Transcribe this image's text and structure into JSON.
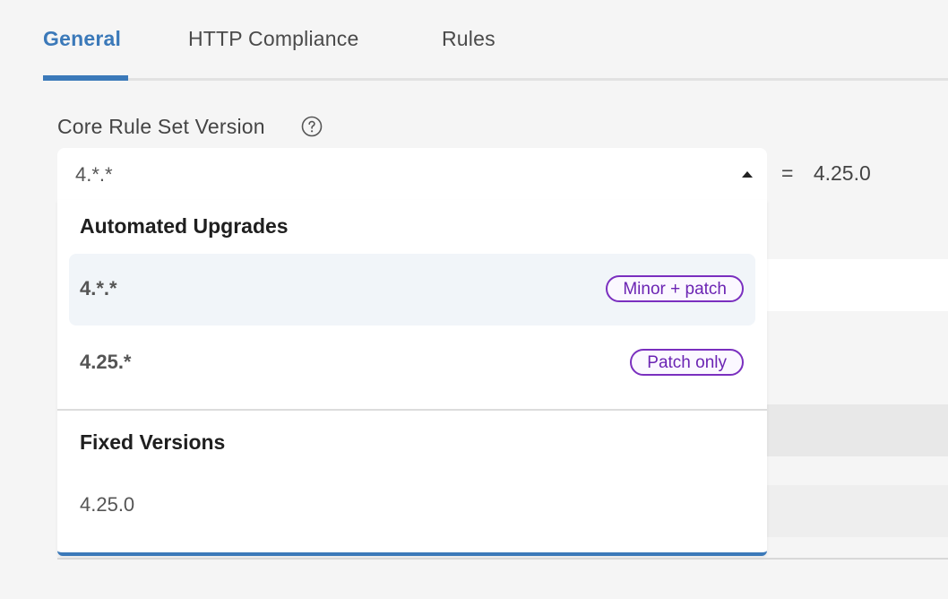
{
  "tabs": [
    {
      "label": "General",
      "active": true
    },
    {
      "label": "HTTP Compliance",
      "active": false
    },
    {
      "label": "Rules",
      "active": false
    }
  ],
  "field": {
    "label": "Core Rule Set Version",
    "help_icon": "question-circle-icon",
    "selected_value": "4.*.*",
    "caret_icon": "caret-up-icon",
    "resolved_prefix": "=",
    "resolved_version": "4.25.0"
  },
  "dropdown": {
    "groups": [
      {
        "title": "Automated Upgrades",
        "options": [
          {
            "label": "4.*.*",
            "badge": "Minor + patch",
            "highlighted": true
          },
          {
            "label": "4.25.*",
            "badge": "Patch only",
            "highlighted": false
          }
        ]
      },
      {
        "title": "Fixed Versions",
        "options": [
          {
            "label": "4.25.0"
          }
        ]
      }
    ]
  },
  "colors": {
    "accent": "#3b79b9",
    "badge_border": "#7a2fbf",
    "badge_text": "#6b24b3",
    "highlight_bg": "#f1f5f9",
    "page_bg": "#f5f5f5"
  }
}
